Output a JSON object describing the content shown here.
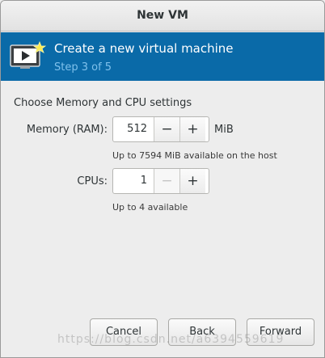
{
  "window": {
    "title": "New VM"
  },
  "header": {
    "title": "Create a new virtual machine",
    "step": "Step 3 of 5",
    "icon": "vm-monitor-icon"
  },
  "section": {
    "title": "Choose Memory and CPU settings"
  },
  "memory": {
    "label": "Memory (RAM):",
    "value": "512",
    "decrement": "−",
    "increment": "+",
    "unit": "MiB",
    "hint": "Up to 7594 MiB available on the host"
  },
  "cpus": {
    "label": "CPUs:",
    "value": "1",
    "decrement": "−",
    "increment": "+",
    "hint": "Up to 4 available",
    "decrement_disabled": true
  },
  "buttons": {
    "cancel": "Cancel",
    "back": "Back",
    "forward": "Forward"
  },
  "watermark": "https://blog.csdn.net/a6394559619"
}
